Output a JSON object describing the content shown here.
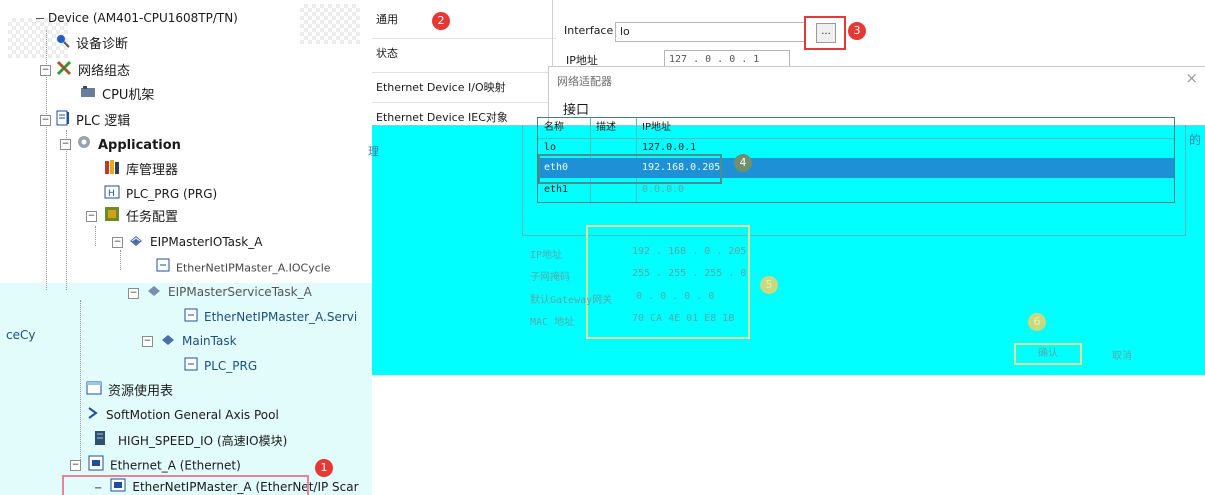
{
  "tree": {
    "device": "Device (AM401-CPU1608TP/TN)",
    "diagnostics": "设备诊断",
    "network_config": "网络组态",
    "cpu_rack": "CPU机架",
    "plc_logic": "PLC 逻辑",
    "application": "Application",
    "library_manager": "库管理器",
    "plc_prg": "PLC_PRG (PRG)",
    "task_config": "任务配置",
    "eip_io_task": "EIPMasterIOTask_A",
    "eip_io_cycle": "EtherNetIPMaster_A.IOCycle",
    "eip_service_task": "EIPMasterServiceTask_A",
    "eip_service": "EtherNetIPMaster_A.Servi",
    "clipped_left": "ceCy",
    "main_task": "MainTask",
    "main_plc_prg": "PLC_PRG",
    "resource_table": "资源使用表",
    "softmotion": "SoftMotion General Axis Pool",
    "high_speed_io": "HIGH_SPEED_IO (高速IO模块)",
    "ethernet_a": "Ethernet_A (Ethernet)",
    "eip_master": "EtherNetIPMaster_A (EtherNet/IP Scar"
  },
  "tabs": [
    "通用",
    "状态",
    "Ethernet Device I/O映射",
    "Ethernet Device IEC对象"
  ],
  "general": {
    "interface_label": "Interface",
    "interface_value": "lo",
    "browse_label": "...",
    "ip_label": "IP地址",
    "ip_value": "127  .  0  .  0  .  1"
  },
  "dialog": {
    "title": "网络适配器",
    "close": "×",
    "section": "接口",
    "columns": [
      "名称",
      "描述",
      "IP地址"
    ],
    "adapters": [
      {
        "name": "lo",
        "desc": "",
        "ip": "127.0.0.1"
      },
      {
        "name": "eth0",
        "desc": "",
        "ip": "192.168.0.205"
      },
      {
        "name": "eth1",
        "desc": "",
        "ip": "0.0.0.0"
      }
    ],
    "details": [
      {
        "label": "IP地址",
        "value": "192  .  168  .  0  .  205"
      },
      {
        "label": "子网掩码",
        "value": "255  .  255  .  255  .  0"
      },
      {
        "label": "默认Gateway网关",
        "value": "0  .  0  .  0  .  0"
      },
      {
        "label": "MAC 地址",
        "value": "70 CA 4E 01 E8 1B"
      }
    ],
    "ok": "确认",
    "cancel": "取消"
  },
  "badges": [
    "1",
    "2",
    "3",
    "4",
    "5",
    "6"
  ],
  "colors": {
    "accent_red": "#e53935",
    "cyan": "#00ffff",
    "selected_row": "#1e90d6",
    "highlight_box": "#e8839a"
  }
}
